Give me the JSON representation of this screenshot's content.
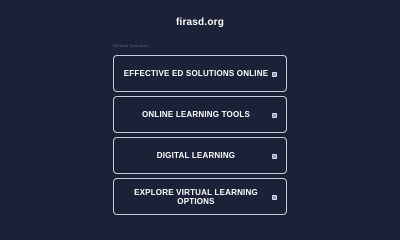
{
  "header": {
    "site_title": "firasd.org"
  },
  "related": {
    "label": "Related Searches"
  },
  "links": [
    {
      "label": "EFFECTIVE ED SOLUTIONS ONLINE",
      "icon": "arrow-icon"
    },
    {
      "label": "ONLINE LEARNING TOOLS",
      "icon": "arrow-icon"
    },
    {
      "label": "DIGITAL LEARNING",
      "icon": "arrow-icon"
    },
    {
      "label": "EXPLORE VIRTUAL LEARNING OPTIONS",
      "icon": "arrow-icon"
    }
  ],
  "colors": {
    "background": "#1b2238",
    "button_border": "#c9ccd6",
    "text": "#ffffff"
  }
}
